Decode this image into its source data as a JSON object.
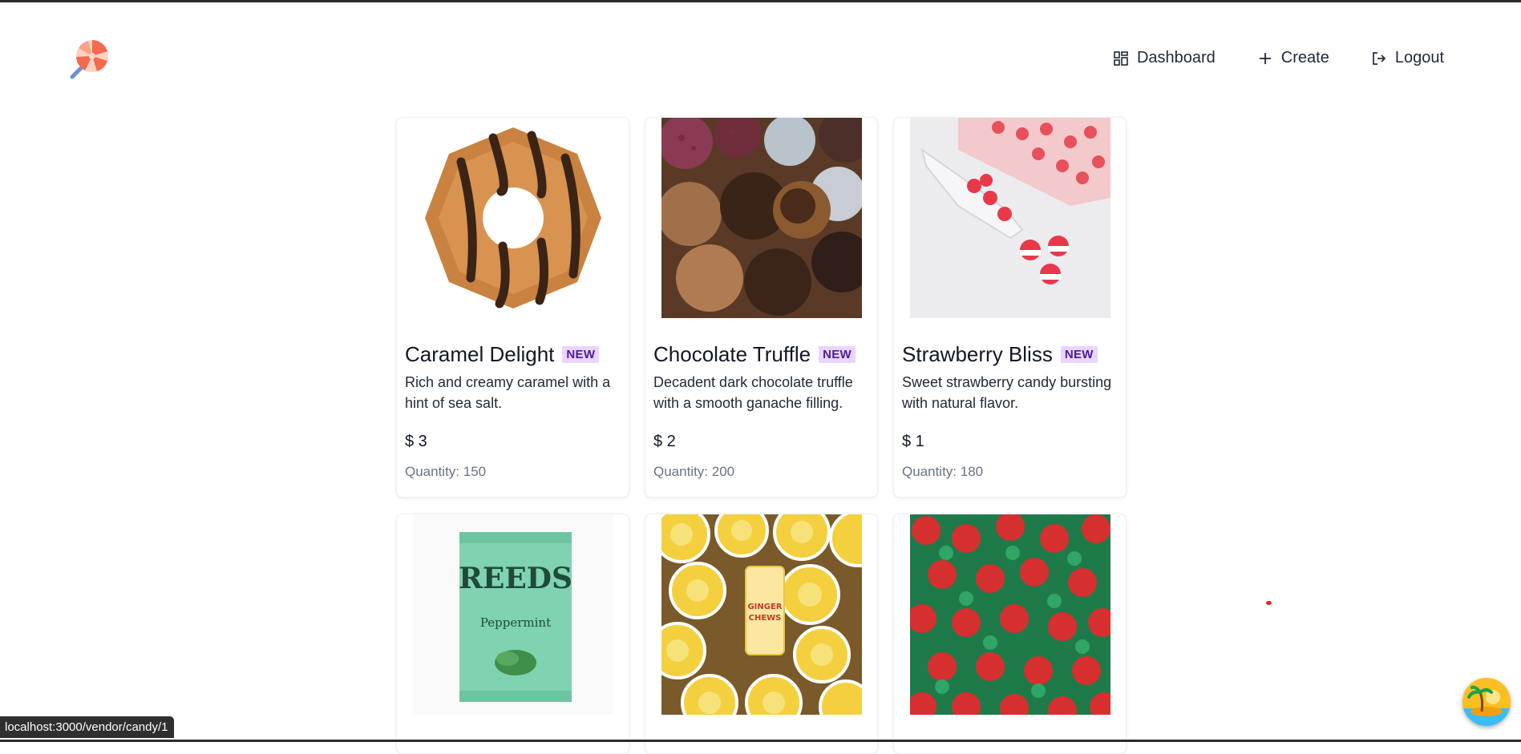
{
  "nav": {
    "dashboard": "Dashboard",
    "create": "Create",
    "logout": "Logout"
  },
  "badge_text": "NEW",
  "candies": [
    {
      "name": "Caramel Delight",
      "description": "Rich and creamy caramel with a hint of sea salt.",
      "price": "$ 3",
      "quantity": "Quantity: 150",
      "image": "coconut-caramel-cookie"
    },
    {
      "name": "Chocolate Truffle",
      "description": "Decadent dark chocolate truffle with a smooth ganache filling.",
      "price": "$ 2",
      "quantity": "Quantity: 200",
      "image": "chocolate-truffles"
    },
    {
      "name": "Strawberry Bliss",
      "description": "Sweet strawberry candy bursting with natural flavor.",
      "price": "$ 1",
      "quantity": "Quantity: 180",
      "image": "strawberry-gummies-scoop"
    },
    {
      "image": "reeds-peppermint-bag"
    },
    {
      "image": "ginger-chews-lemons"
    },
    {
      "image": "wrapped-strawberry-candies"
    }
  ],
  "status_url": "localhost:3000/vendor/candy/1",
  "colors": {
    "badge_bg": "#e9d5ff",
    "badge_text": "#4c1d95",
    "muted": "#6b7280"
  }
}
